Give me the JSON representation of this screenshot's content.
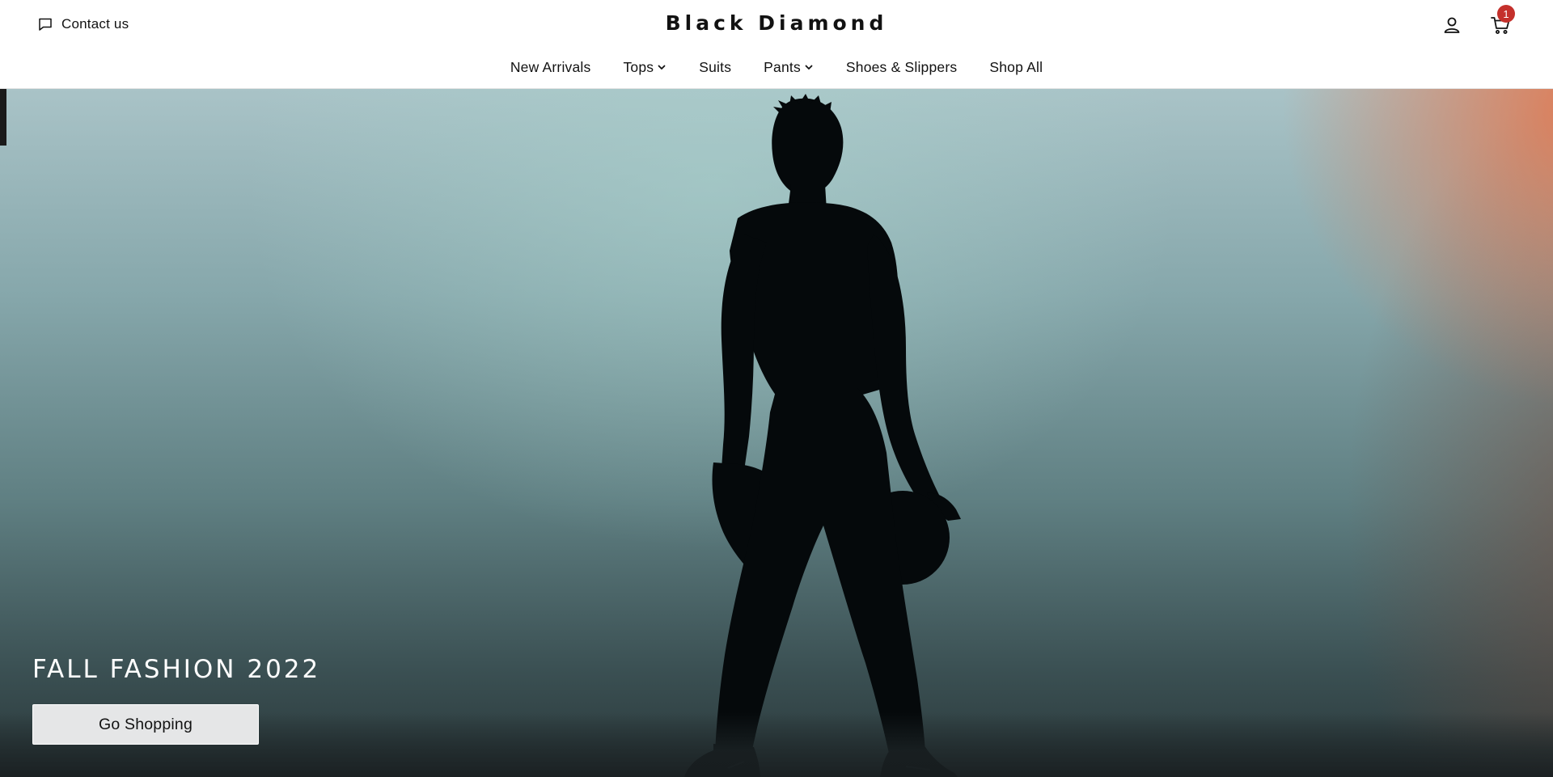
{
  "header": {
    "contact_label": "Contact us",
    "brand": "Black Diamond",
    "cart_count": "1",
    "icons": {
      "contact": "chat-bubble-icon",
      "account": "user-icon",
      "cart": "cart-icon",
      "dropdown": "chevron-down-icon"
    }
  },
  "nav": {
    "items": [
      {
        "label": "New Arrivals",
        "has_dropdown": false
      },
      {
        "label": "Tops",
        "has_dropdown": true
      },
      {
        "label": "Suits",
        "has_dropdown": false
      },
      {
        "label": "Pants",
        "has_dropdown": true
      },
      {
        "label": "Shoes & Slippers",
        "has_dropdown": false
      },
      {
        "label": "Shop All",
        "has_dropdown": false
      }
    ]
  },
  "hero": {
    "heading": "FALL FASHION 2022",
    "button_label": "Go Shopping"
  },
  "colors": {
    "badge": "#c4302b",
    "text": "#121212",
    "button_bg": "#e5e6e7"
  }
}
